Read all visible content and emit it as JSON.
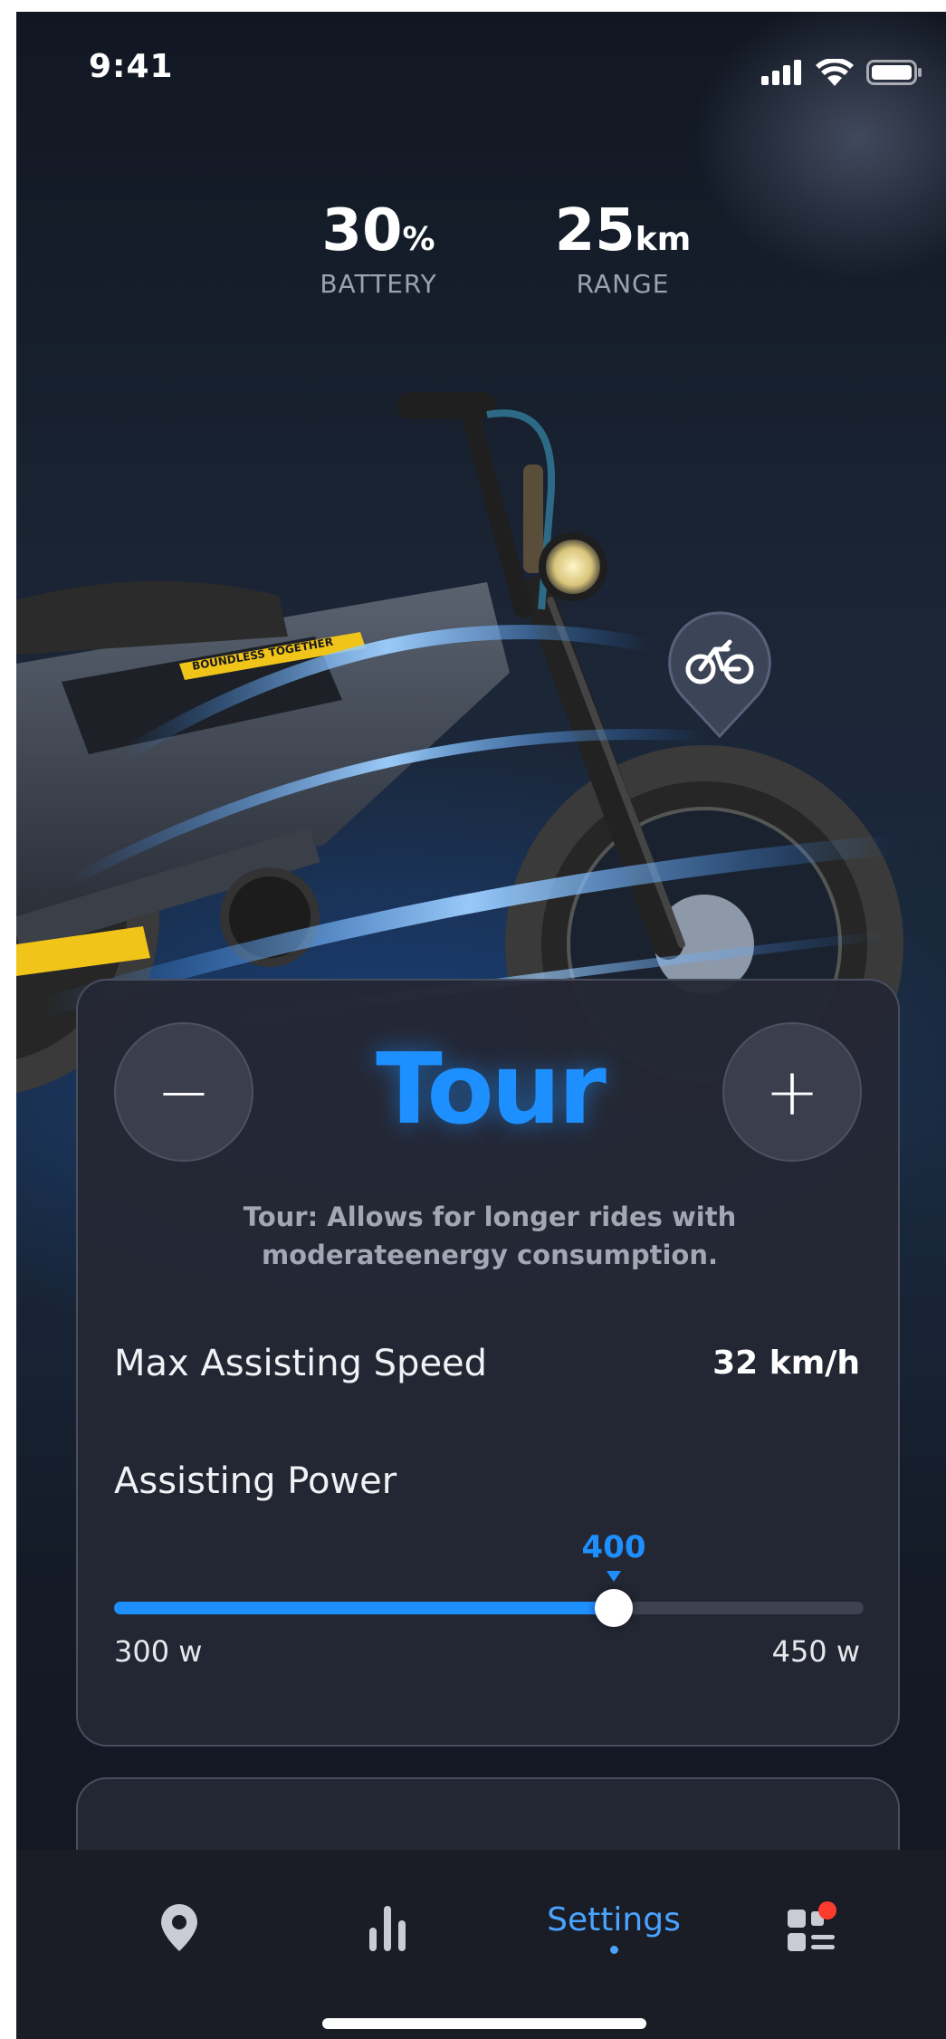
{
  "status_bar": {
    "time": "9:41"
  },
  "stats": {
    "battery_value": "30",
    "battery_unit": "%",
    "battery_label": "BATTERY",
    "range_value": "25",
    "range_unit": "km",
    "range_label": "RANGE"
  },
  "bike_decal": "BOUNDLESS TOGETHER",
  "mode_card": {
    "minus_label": "−",
    "plus_label": "+",
    "mode_name": "Tour",
    "description": "Tour: Allows for longer rides with moderateenergy consumption.",
    "max_speed_label": "Max Assisting Speed",
    "max_speed_value": "32 km/h",
    "assist_power_label": "Assisting Power",
    "slider": {
      "value_label": "400",
      "min_label": "300 w",
      "max_label": "450 w",
      "value": 400,
      "min": 300,
      "max": 450
    }
  },
  "tab_bar": {
    "settings_label": "Settings",
    "active_tab": "settings"
  },
  "colors": {
    "accent": "#1e8fff",
    "card_bg": "#242834",
    "badge_red": "#ff3b30"
  },
  "icons": {
    "signal": "cellular-signal-icon",
    "wifi": "wifi-icon",
    "battery": "battery-icon",
    "bike_marker": "bicycle-icon",
    "map_tab": "location-pin-icon",
    "stats_tab": "bar-chart-icon",
    "apps_tab": "grid-menu-icon"
  }
}
